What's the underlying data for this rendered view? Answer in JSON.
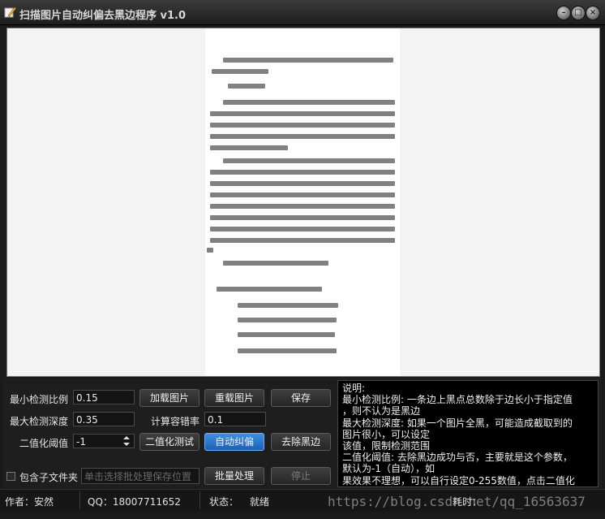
{
  "window": {
    "title": "扫描图片自动纠偏去黑边程序 v1.0"
  },
  "controls": {
    "min_ratio_label": "最小检测比例",
    "min_ratio_value": "0.15",
    "max_depth_label": "最大检测深度",
    "max_depth_value": "0.35",
    "threshold_label": "二值化阈值",
    "threshold_value": "-1",
    "tolerance_label": "计算容错率",
    "tolerance_value": "0.1",
    "include_subfolders_label": "包含子文件夹",
    "batch_path_placeholder": "单击选择批处理保存位置"
  },
  "buttons": {
    "load": "加载图片",
    "reload": "重载图片",
    "save": "保存",
    "binarize_test": "二值化测试",
    "auto_deskew": "自动纠偏",
    "remove_black": "去除黑边",
    "batch": "批量处理",
    "stop": "停止"
  },
  "help": {
    "lines": [
      "说明:",
      "最小检测比例: 一条边上黑点总数除于边长小于指定值",
      "，则不认为是黑边",
      "最大检测深度: 如果一个图片全黑，可能造成截取到的",
      "图片很小，可以设定",
      "该值，限制检测范围",
      "二值化阈值: 去除黑边成功与否，主要就是这个参数，",
      "默认为-1（自动），如",
      "果效果不理想，可以自行设定0-255数值，点击二值化"
    ]
  },
  "status": {
    "author": "作者：安然",
    "qq": "QQ：18007711652",
    "state_label": "状态：",
    "state_value": "就绪",
    "elapsed_label": "耗时："
  },
  "watermark": "https://blog.csdn.net/qq_16563637",
  "colors": {
    "active_button": "#2f7fd6",
    "background": "#1a1a1a"
  }
}
